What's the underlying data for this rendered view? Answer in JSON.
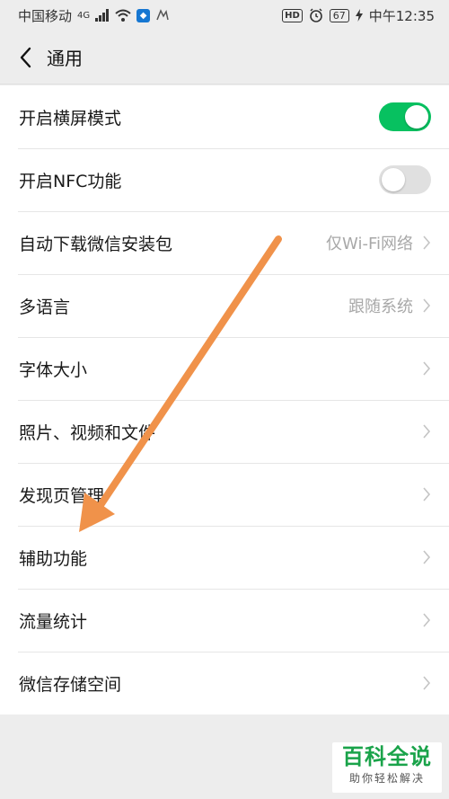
{
  "status_bar": {
    "carrier": "中国移动",
    "network": "4G",
    "hd_label": "HD",
    "battery": "67",
    "time_label": "中午12:35"
  },
  "nav": {
    "title": "通用"
  },
  "settings": [
    {
      "label": "开启横屏模式",
      "control": "toggle",
      "on": true
    },
    {
      "label": "开启NFC功能",
      "control": "toggle",
      "on": false
    },
    {
      "label": "自动下载微信安装包",
      "control": "chevron",
      "value": "仅Wi-Fi网络"
    },
    {
      "label": "多语言",
      "control": "chevron",
      "value": "跟随系统"
    },
    {
      "label": "字体大小",
      "control": "chevron",
      "value": ""
    },
    {
      "label": "照片、视频和文件",
      "control": "chevron",
      "value": ""
    },
    {
      "label": "发现页管理",
      "control": "chevron",
      "value": ""
    },
    {
      "label": "辅助功能",
      "control": "chevron",
      "value": ""
    },
    {
      "label": "流量统计",
      "control": "chevron",
      "value": ""
    },
    {
      "label": "微信存储空间",
      "control": "chevron",
      "value": ""
    }
  ],
  "watermark": {
    "title": "百科全说",
    "subtitle": "助你轻松解决"
  },
  "colors": {
    "toggle_on": "#07c160",
    "toggle_off": "#e0e0e0",
    "arrow": "#f0924a",
    "page_bg": "#ededed"
  },
  "icons": {
    "back": "chevron-left-icon",
    "row_arrow": "chevron-right-icon",
    "wifi": "wifi-icon",
    "alarm": "alarm-icon",
    "charging": "bolt-icon"
  }
}
